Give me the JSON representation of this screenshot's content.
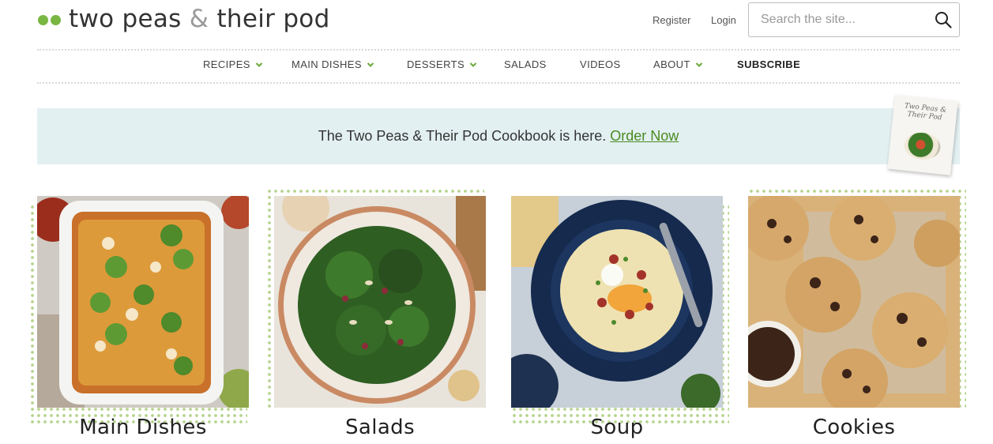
{
  "header": {
    "logo_text_1": "two peas",
    "logo_amp": "&",
    "logo_text_2": "their pod",
    "register_label": "Register",
    "login_label": "Login",
    "search_placeholder": "Search the site...",
    "search_value": ""
  },
  "nav": {
    "items": [
      {
        "label": "RECIPES",
        "has_dropdown": true
      },
      {
        "label": "MAIN DISHES",
        "has_dropdown": true
      },
      {
        "label": "DESSERTS",
        "has_dropdown": true
      },
      {
        "label": "SALADS",
        "has_dropdown": false
      },
      {
        "label": "VIDEOS",
        "has_dropdown": false
      },
      {
        "label": "ABOUT",
        "has_dropdown": true
      },
      {
        "label": "SUBSCRIBE",
        "has_dropdown": false
      }
    ]
  },
  "banner": {
    "text": "The Two Peas & Their Pod Cookbook is here.",
    "link_label": "Order Now",
    "book_title": "Two Peas & Their Pod"
  },
  "categories": [
    {
      "title": "Main Dishes",
      "image": "enchiladas-photo"
    },
    {
      "title": "Salads",
      "image": "kale-salad-photo"
    },
    {
      "title": "Soup",
      "image": "potato-soup-photo"
    },
    {
      "title": "Cookies",
      "image": "chocolate-chip-cookies-photo"
    }
  ],
  "colors": {
    "brand_green": "#7ab642",
    "link_green": "#4a8a21",
    "banner_bg": "#e3f0f2",
    "dot_green": "#b6d38f"
  }
}
